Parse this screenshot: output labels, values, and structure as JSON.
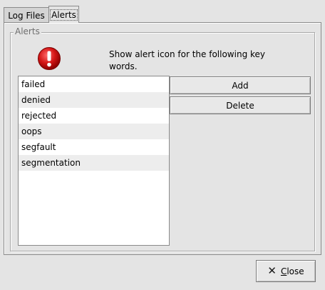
{
  "tabs": [
    {
      "label": "Log Files"
    },
    {
      "label": "Alerts"
    }
  ],
  "frame": {
    "legend": "Alerts",
    "icon": "alert-icon",
    "description_line1": "Show alert icon for the following key",
    "description_line2": "words."
  },
  "keywords": [
    "failed",
    "denied",
    "rejected",
    "oops",
    "segfault",
    "segmentation"
  ],
  "buttons": {
    "add": "Add",
    "delete": "Delete",
    "close_mnemonic": "C",
    "close_rest": "lose",
    "close_icon": "close-icon"
  },
  "colors": {
    "alert_red": "#cc1111",
    "window_bg": "#e4e4e4",
    "list_alt_row": "#ededed"
  }
}
